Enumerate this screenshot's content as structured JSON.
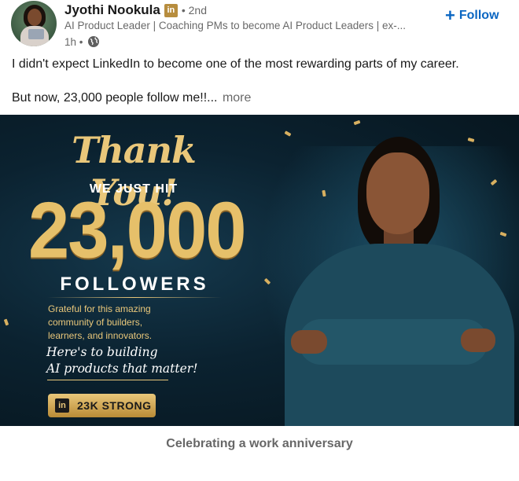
{
  "author": {
    "name": "Jyothi Nookula",
    "badge_icon": "linkedin-premium-icon",
    "badge_text": "in",
    "degree": "• 2nd",
    "headline": "AI Product Leader | Coaching PMs to become AI Product Leaders | ex-...",
    "time": "1h •",
    "visibility_icon": "globe-icon"
  },
  "follow": {
    "plus": "+",
    "label": "Follow",
    "color": "#0a66c2"
  },
  "post": {
    "paragraph_1": "I didn't expect LinkedIn to become one of the most rewarding parts of my career.",
    "paragraph_2": "But now, 23,000 people follow me!!...",
    "more_label": "more"
  },
  "image": {
    "thank_you": "Thank You!",
    "we_just_hit": "WE JUST HIT",
    "count": "23,000",
    "followers_word": "FOLLOWERS",
    "grateful_lines": [
      "Grateful for this amazing",
      "community of builders,",
      "learners, and innovators."
    ],
    "script_lines": [
      "Here's to building",
      "AI products that matter!"
    ],
    "badge_in": "in",
    "badge_label": "23K STRONG",
    "gold": "#e9c77a",
    "background": "#0b2230"
  },
  "caption": "Celebrating a work anniversary"
}
